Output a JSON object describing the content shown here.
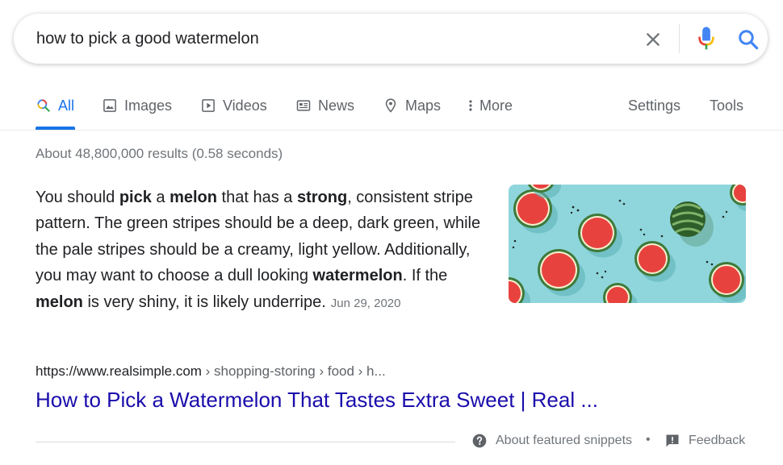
{
  "search": {
    "query": "how to pick a good watermelon"
  },
  "tabs": [
    {
      "label": "All",
      "icon": "search-icon",
      "active": true
    },
    {
      "label": "Images",
      "icon": "image-icon"
    },
    {
      "label": "Videos",
      "icon": "play-icon"
    },
    {
      "label": "News",
      "icon": "newspaper-icon"
    },
    {
      "label": "Maps",
      "icon": "map-pin-icon"
    },
    {
      "label": "More",
      "icon": "more-vert-icon"
    }
  ],
  "tools": {
    "settings": "Settings",
    "tools": "Tools"
  },
  "result_stats": "About 48,800,000 results (0.58 seconds)",
  "snippet": {
    "parts": [
      {
        "text": "You should ",
        "bold": false
      },
      {
        "text": "pick",
        "bold": true
      },
      {
        "text": " a ",
        "bold": false
      },
      {
        "text": "melon",
        "bold": true
      },
      {
        "text": " that has a ",
        "bold": false
      },
      {
        "text": "strong",
        "bold": true
      },
      {
        "text": ", consistent stripe pattern. The green stripes should be a deep, dark green, while the pale stripes should be a creamy, light yellow. Additionally, you may want to choose a dull looking ",
        "bold": false
      },
      {
        "text": "watermelon",
        "bold": true
      },
      {
        "text": ". If the ",
        "bold": false
      },
      {
        "text": "melon",
        "bold": true
      },
      {
        "text": " is very shiny, it is likely underripe.",
        "bold": false
      }
    ],
    "date": "Jun 29, 2020"
  },
  "result": {
    "url": "https://www.realsimple.com",
    "breadcrumb": " › shopping-storing › food › h...",
    "title": "How to Pick a Watermelon That Tastes Extra Sweet | Real ..."
  },
  "footer": {
    "about": "About featured snippets",
    "separator": "•",
    "feedback": "Feedback"
  },
  "colors": {
    "accent": "#1a73e8",
    "link": "#1a0dab",
    "image_bg": "#8fd6dc",
    "melon_red": "#e8423f"
  }
}
